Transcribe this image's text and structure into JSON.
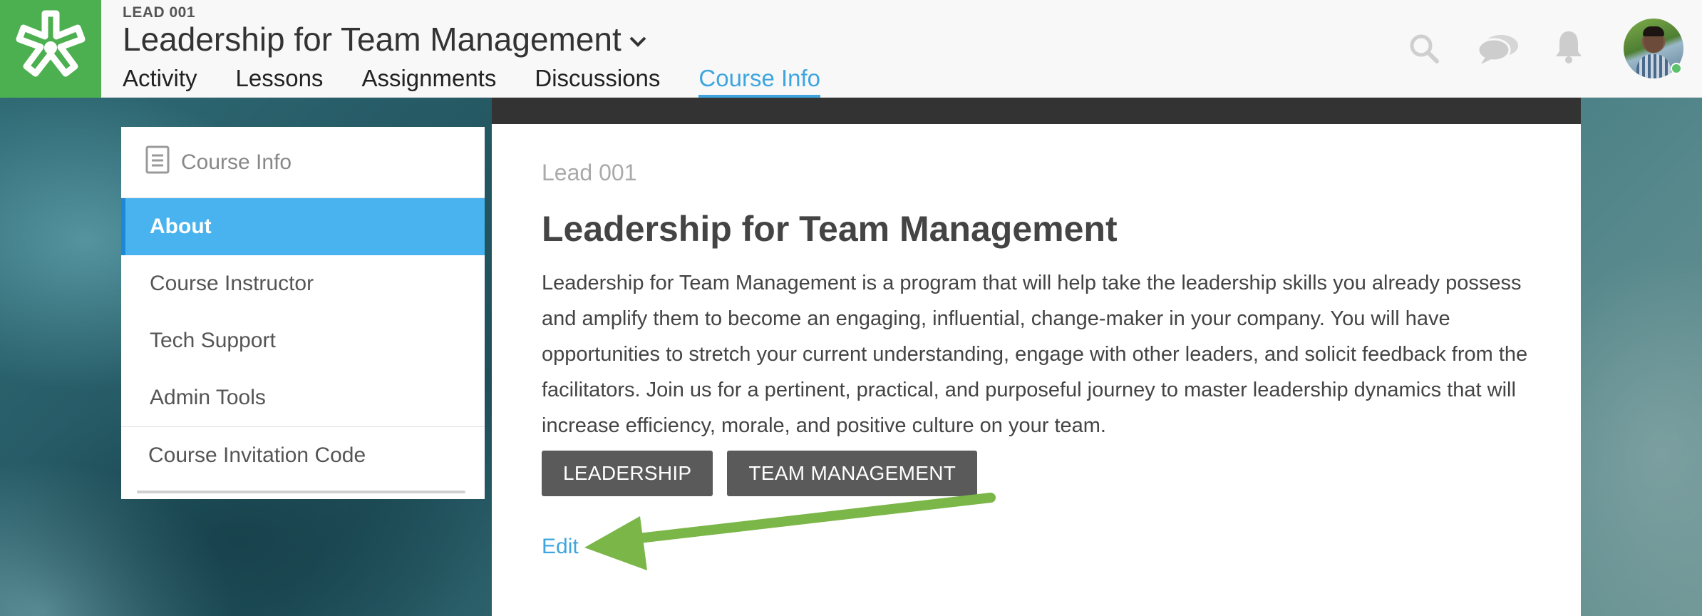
{
  "header": {
    "course_code": "LEAD 001",
    "course_title": "Leadership for Team Management",
    "tabs": [
      {
        "label": "Activity",
        "active": false
      },
      {
        "label": "Lessons",
        "active": false
      },
      {
        "label": "Assignments",
        "active": false
      },
      {
        "label": "Discussions",
        "active": false
      },
      {
        "label": "Course Info",
        "active": true
      }
    ],
    "icons": [
      "search-icon",
      "chat-icon",
      "bell-icon"
    ],
    "user_status": "online"
  },
  "sidebar": {
    "title": "Course Info",
    "items": [
      {
        "label": "About",
        "active": true
      },
      {
        "label": "Course Instructor",
        "active": false
      },
      {
        "label": "Tech Support",
        "active": false
      },
      {
        "label": "Admin Tools",
        "active": false
      }
    ],
    "invite_label": "Course Invitation Code"
  },
  "main": {
    "code": "Lead 001",
    "title": "Leadership for Team Management",
    "description": "Leadership for Team Management is a program that will help take the leadership skills you already possess and amplify them to become an engaging, influential, change-maker in your company. You will have opportunities to stretch your current understanding, engage with other leaders, and solicit feedback from the facilitators. Join us for a pertinent, practical, and purposeful journey to master leadership dynamics that will increase efficiency, morale, and positive culture on your team.",
    "tags": [
      "LEADERSHIP",
      "TEAM MANAGEMENT"
    ],
    "edit_label": "Edit"
  },
  "colors": {
    "brand_green": "#4caf50",
    "accent_blue": "#3ea5df",
    "sidebar_active": "#48b3ee",
    "tag_bg": "#5a5a5a",
    "arrow_green": "#7ab648"
  }
}
